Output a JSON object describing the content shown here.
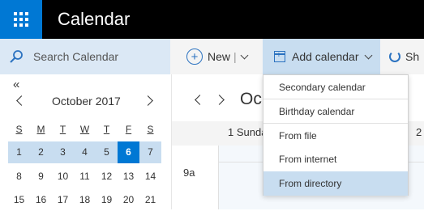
{
  "app": {
    "title": "Calendar"
  },
  "search": {
    "label": "Search Calendar"
  },
  "toolbar": {
    "new_label": "New",
    "new_separator": "|",
    "add_calendar_label": "Add calendar",
    "share_label": "Sh"
  },
  "add_calendar_menu": {
    "items": [
      "Secondary calendar",
      "Birthday calendar",
      "From file",
      "From internet",
      "From directory"
    ]
  },
  "mini_calendar": {
    "collapse_glyph": "«",
    "month_label": "October 2017",
    "weekdays": [
      "S",
      "M",
      "T",
      "W",
      "T",
      "F",
      "S"
    ],
    "weeks": [
      [
        "1",
        "2",
        "3",
        "4",
        "5",
        "6",
        "7"
      ],
      [
        "8",
        "9",
        "10",
        "11",
        "12",
        "13",
        "14"
      ],
      [
        "15",
        "16",
        "17",
        "18",
        "19",
        "20",
        "21"
      ]
    ],
    "selected_day": "6"
  },
  "main_view": {
    "range_title": "Oc",
    "day_header_1": "1 Sunda",
    "day_header_2": "2",
    "hour_label": "9a"
  },
  "colors": {
    "accent": "#0078d4",
    "selection": "#c8ddf0",
    "titlebar": "#000000"
  }
}
